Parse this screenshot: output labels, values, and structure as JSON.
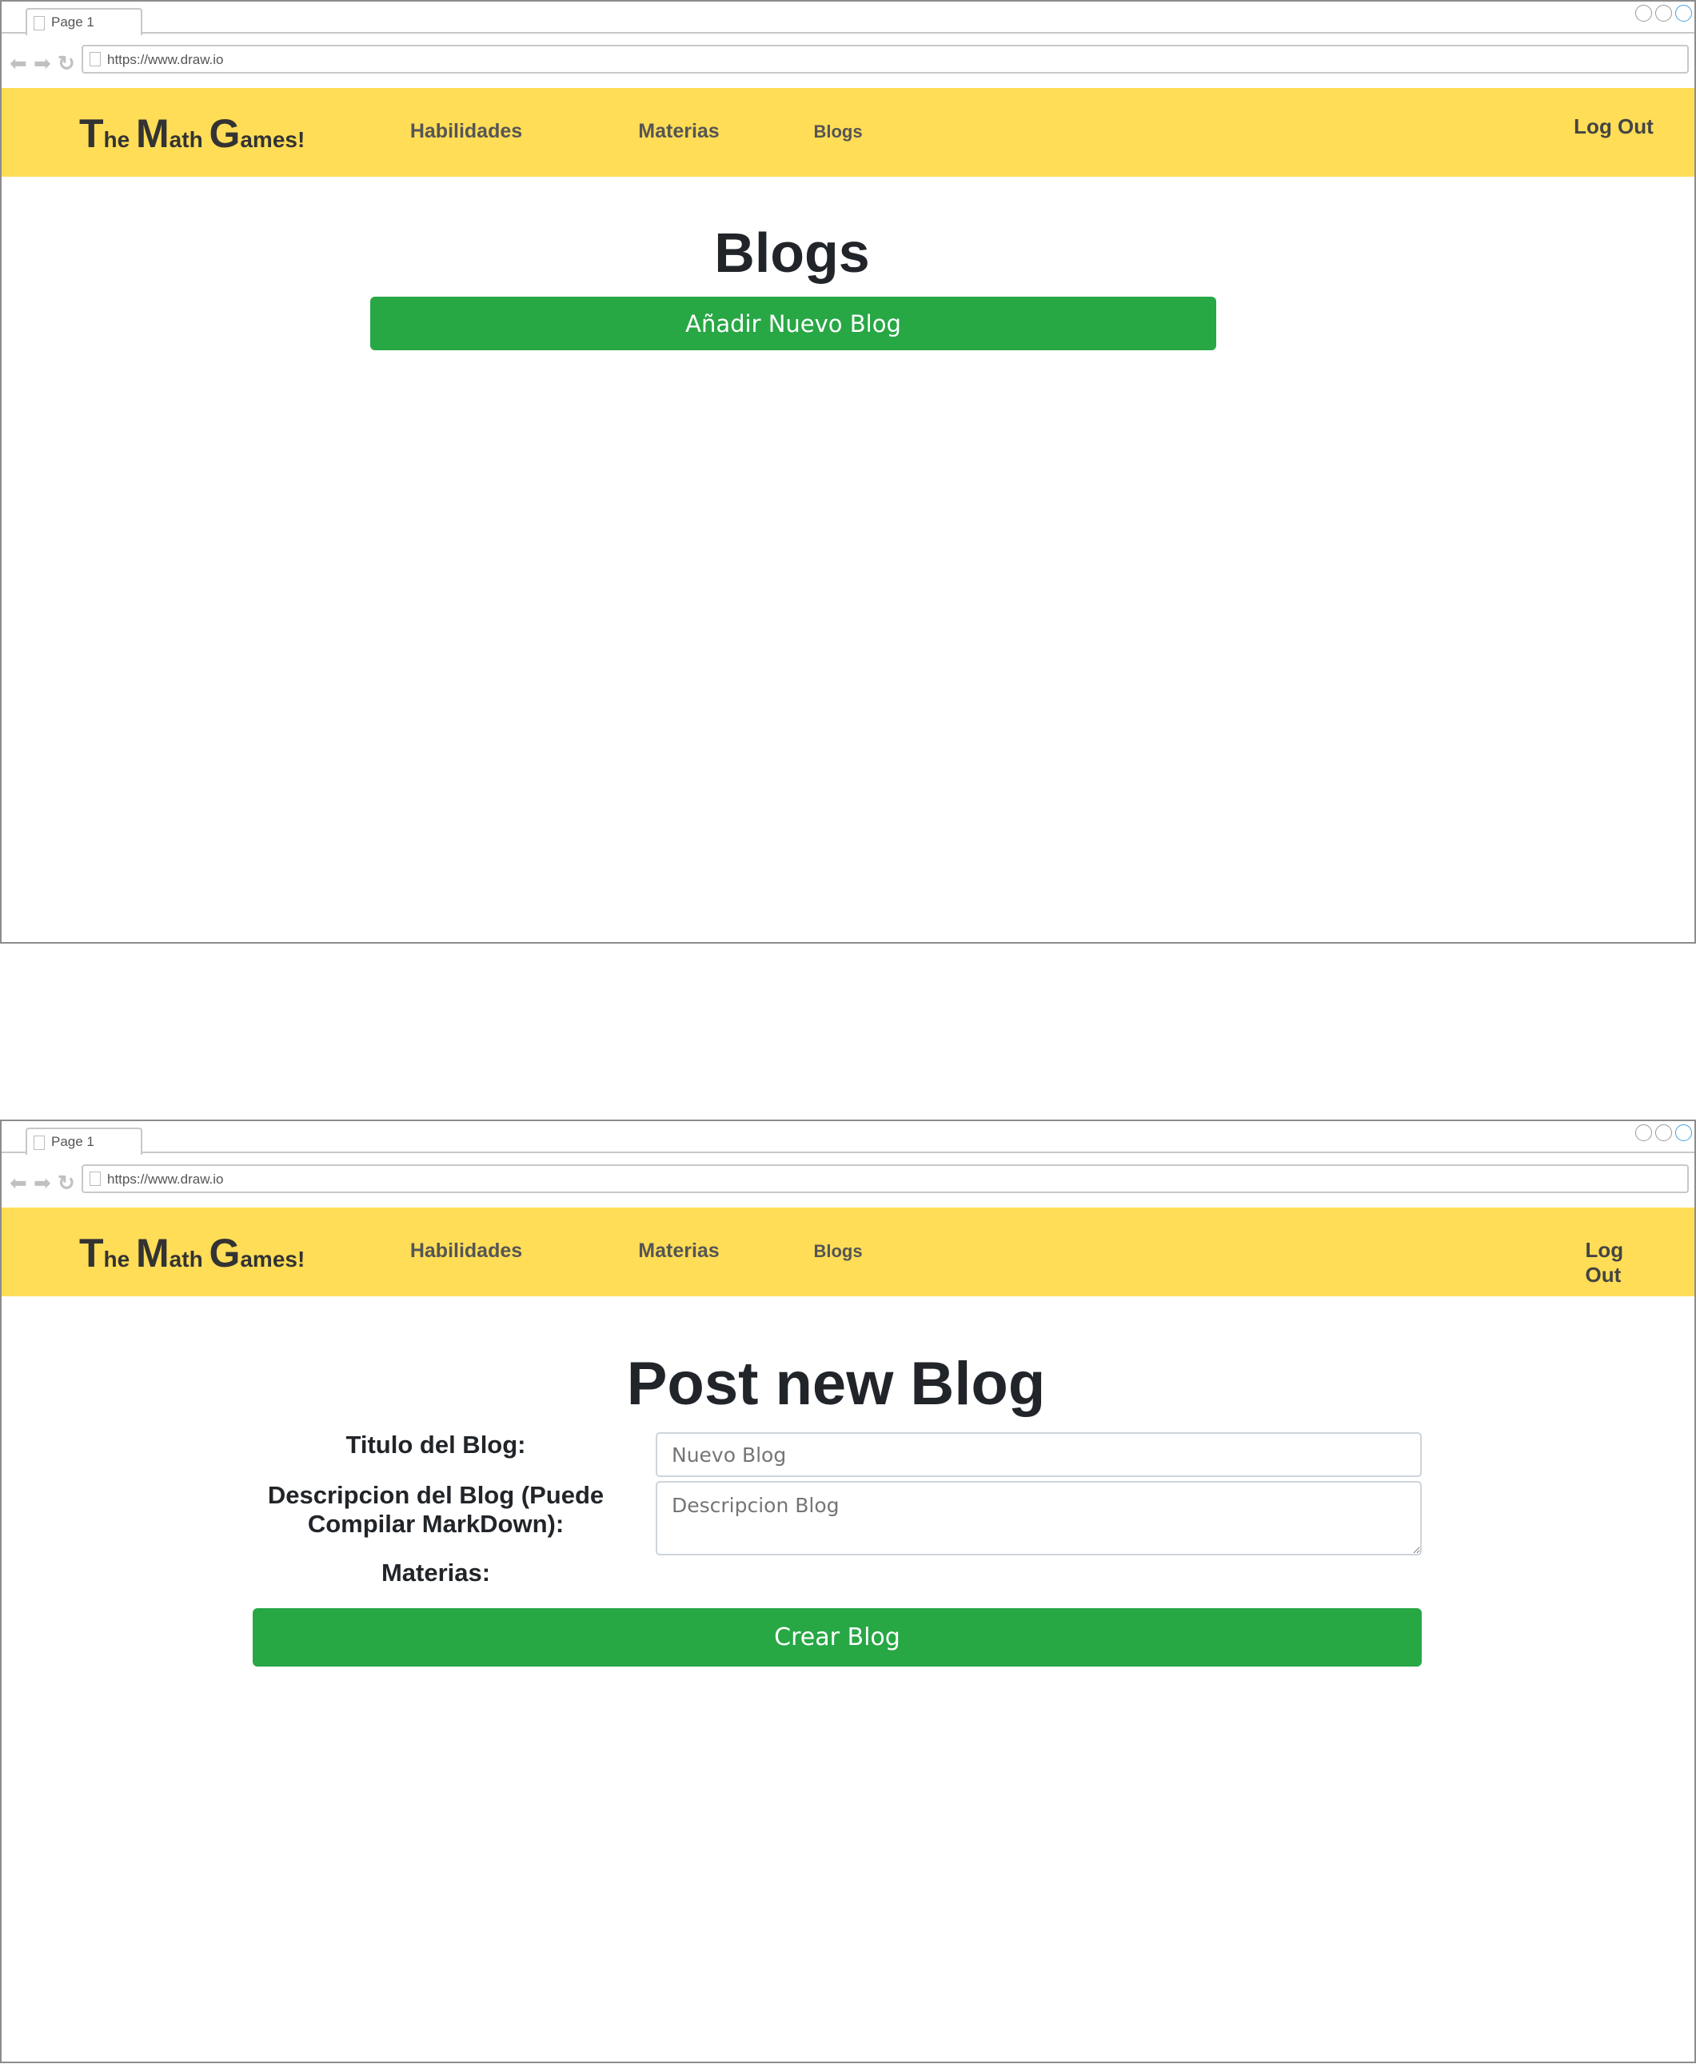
{
  "browser": {
    "tab_label": "Page 1",
    "url": "https://www.draw.io"
  },
  "navbar": {
    "logo": {
      "t": "T",
      "he": "he ",
      "m": "M",
      "ath": "ath ",
      "g": "G",
      "ames": "ames!"
    },
    "links": [
      "Habilidades",
      "Materias",
      "Blogs"
    ],
    "logout": "Log Out",
    "bg_color": "#ffdd57"
  },
  "screen1": {
    "title": "Blogs",
    "add_button": "Añadir Nuevo Blog"
  },
  "screen2": {
    "title": "Post new Blog",
    "title_label": "Titulo del Blog:",
    "title_placeholder": "Nuevo Blog",
    "desc_label_1": "Descripcion del Blog (Puede",
    "desc_label_2": "Compilar MarkDown):",
    "desc_placeholder": "Descripcion Blog",
    "materias_label": "Materias:",
    "submit_button": "Crear Blog"
  },
  "accent_color": "#28a745"
}
